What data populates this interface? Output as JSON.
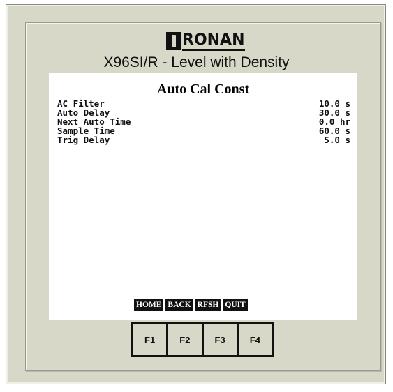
{
  "brand": {
    "logo_text": "RONAN",
    "model_title": "X96SI/R - Level with Density"
  },
  "screen": {
    "title": "Auto Cal Const",
    "params": [
      {
        "label": "AC Filter",
        "value": "10.0 s"
      },
      {
        "label": "Auto Delay",
        "value": "30.0 s"
      },
      {
        "label": "Next Auto Time",
        "value": "0.0 hr"
      },
      {
        "label": "Sample Time",
        "value": "60.0 s"
      },
      {
        "label": "Trig Delay",
        "value": "5.0 s"
      }
    ],
    "softkeys": [
      "HOME",
      "BACK",
      "RFSH",
      "QUIT"
    ]
  },
  "function_keys": [
    "F1",
    "F2",
    "F3",
    "F4"
  ],
  "colors": {
    "bezel": "#d8d8c8",
    "screen": "#ffffff",
    "text": "#111111"
  }
}
